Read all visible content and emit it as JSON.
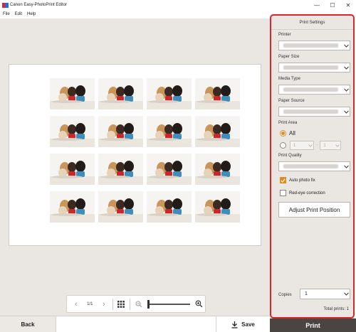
{
  "window": {
    "title": "Canon Easy-PhotoPrint Editor",
    "minimize_glyph": "—",
    "maximize_glyph": "☐",
    "close_glyph": "✕"
  },
  "menu": [
    "File",
    "Edit",
    "Help"
  ],
  "preview": {
    "photo_count": 16
  },
  "pager": {
    "page_label": "1/1",
    "prev_glyph": "‹",
    "next_glyph": "›"
  },
  "bottom": {
    "back_label": "Back",
    "save_label": "Save"
  },
  "settings": {
    "heading": "Print Settings",
    "printer_label": "Printer",
    "paper_size_label": "Paper Size",
    "media_type_label": "Media Type",
    "paper_source_label": "Paper Source",
    "print_area_label": "Print Area",
    "print_area_all": "All",
    "range_from": "1",
    "range_dash": "-",
    "range_to": "1",
    "print_quality_label": "Print Quality",
    "auto_photo_fix_label": "Auto photo fix",
    "auto_photo_fix_checked": true,
    "red_eye_label": "Red-eye correction",
    "red_eye_checked": false,
    "adjust_button": "Adjust Print Position",
    "copies_label": "Copies",
    "copies_value": "1",
    "total_prints": "Total prints: 1"
  },
  "print_button": "Print",
  "colors": {
    "accent_red": "#e0242a",
    "accent_orange": "#e08a20",
    "print_bg": "#4a4542"
  }
}
